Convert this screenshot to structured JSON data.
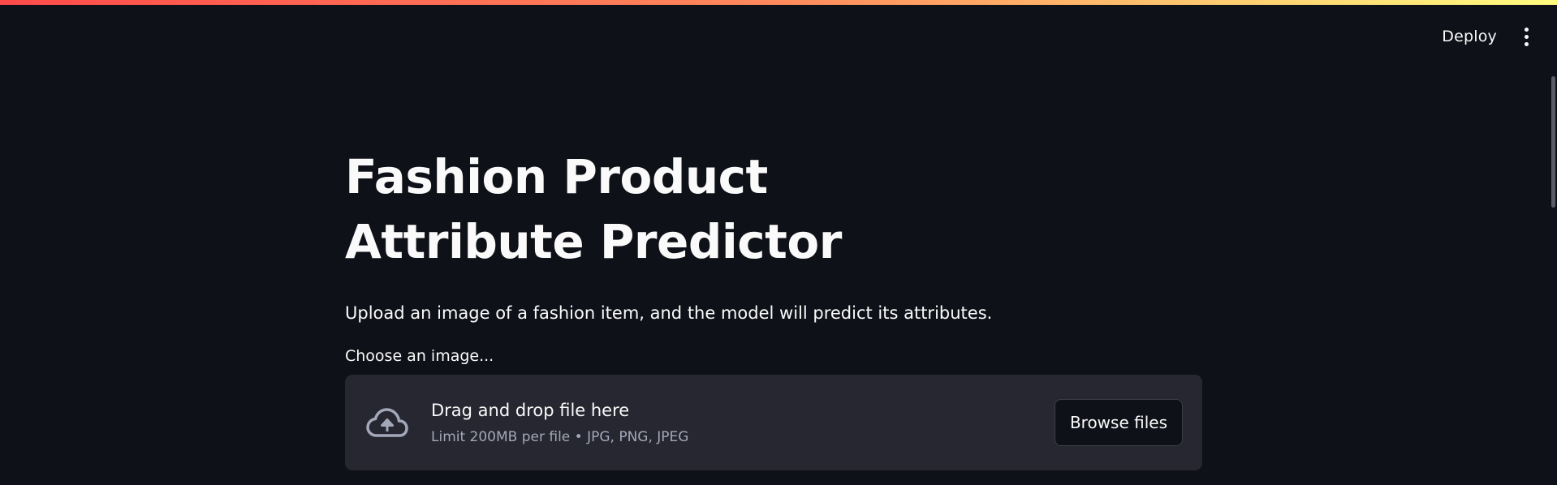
{
  "header": {
    "deploy_label": "Deploy",
    "menu_icon": "kebab-menu-icon"
  },
  "main": {
    "title": "Fashion Product Attribute Predictor",
    "description": "Upload an image of a fashion item, and the model will predict its attributes."
  },
  "uploader": {
    "label": "Choose an image...",
    "drop_text": "Drag and drop file here",
    "limit_text": "Limit 200MB per file • JPG, PNG, JPEG",
    "browse_label": "Browse files",
    "icon": "cloud-upload-icon"
  },
  "colors": {
    "background": "#0e1117",
    "dropzone": "#262730",
    "text": "#fafafa",
    "muted_text": "#a3a8b8",
    "accent_gradient": [
      "#ff4b4b",
      "#fffd80"
    ]
  }
}
